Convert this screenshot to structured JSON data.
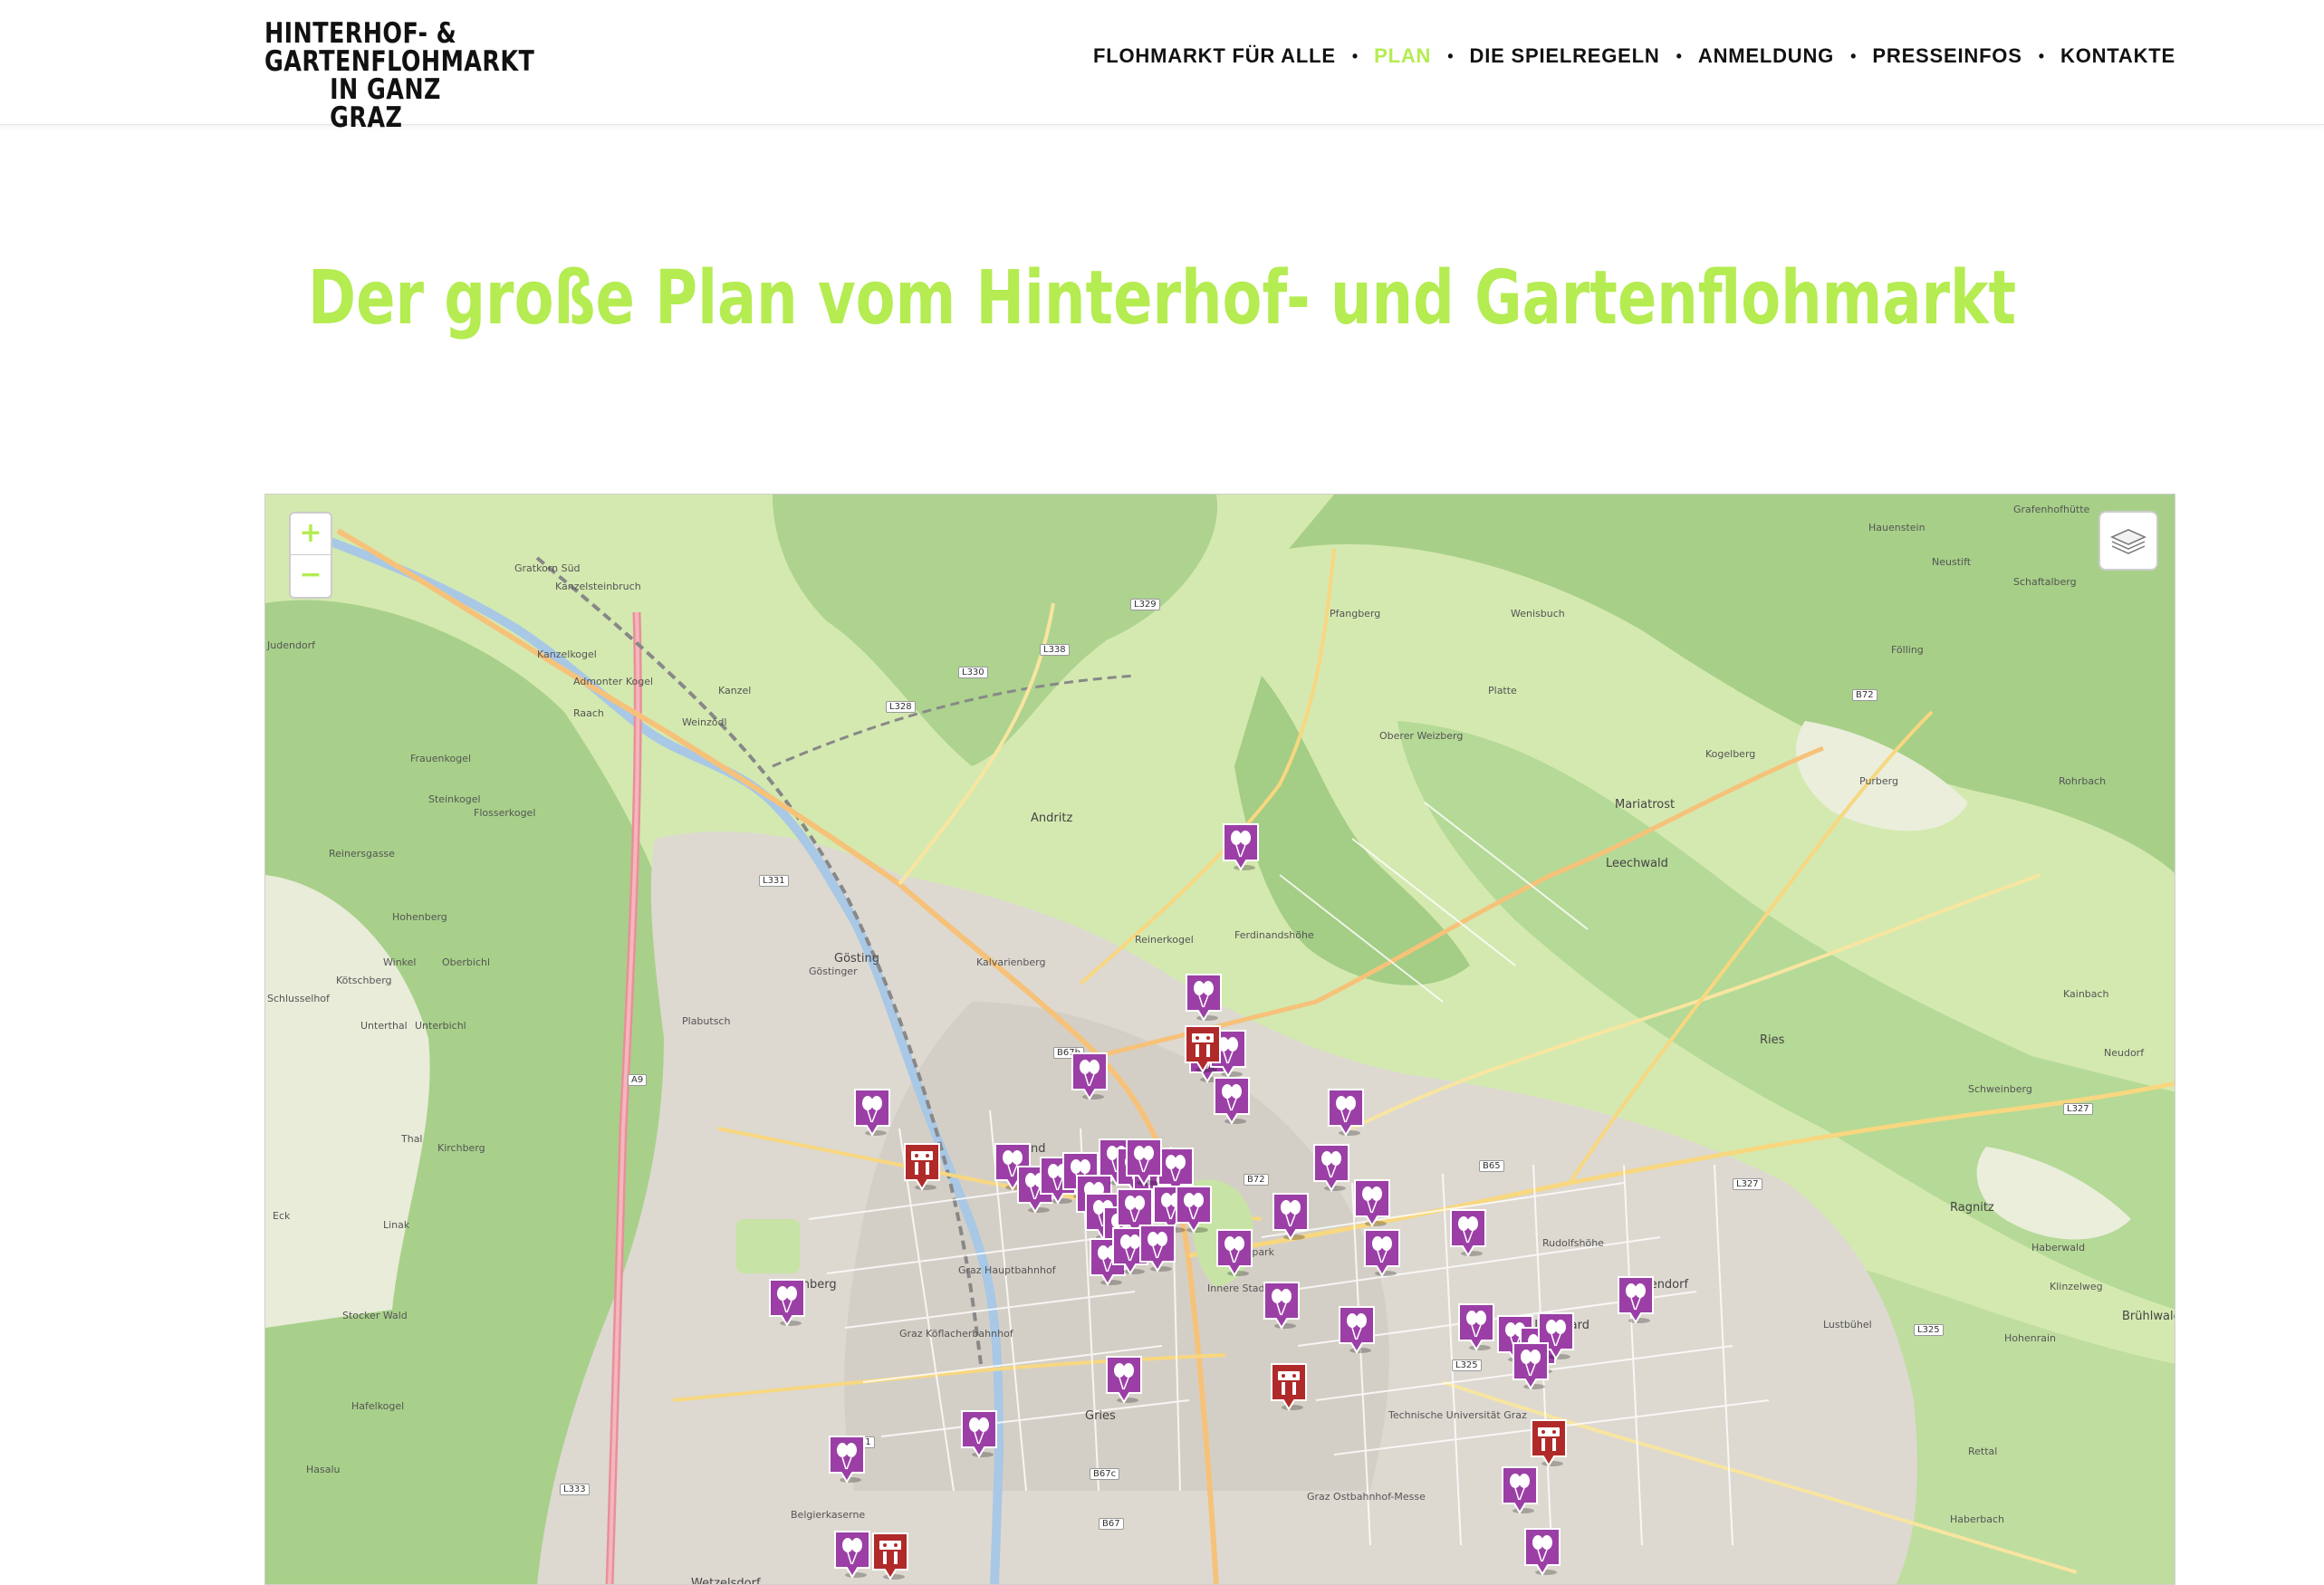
{
  "header": {
    "logo_lines": [
      "HINTERHOF- &",
      "GARTENFLOHMARKT",
      "IN GANZ GRAZ"
    ],
    "nav": [
      {
        "label": "FLOHMARKT FÜR ALLE",
        "active": false
      },
      {
        "label": "PLAN",
        "active": true
      },
      {
        "label": "DIE SPIELREGELN",
        "active": false
      },
      {
        "label": "ANMELDUNG",
        "active": false
      },
      {
        "label": "PRESSEINFOS",
        "active": false
      },
      {
        "label": "KONTAKTE",
        "active": false
      }
    ],
    "accent_color": "#b4ec51"
  },
  "page": {
    "title": "Der große Plan vom Hinterhof- und Gartenflohmarkt"
  },
  "map": {
    "zoom_in": "+",
    "zoom_out": "−",
    "layers_icon": "layers-icon",
    "marker_types": {
      "flohmarkt": {
        "icon": "balloons-icon",
        "color": "#9b3fa6"
      },
      "info": {
        "icon": "stand-icon",
        "color": "#b02a2a"
      }
    },
    "place_labels": [
      "Judendorf",
      "Gratkorn Süd",
      "Kanzelsteinbruch",
      "Kanzelkogel",
      "Admonter Kogel",
      "Kanzel",
      "Raach",
      "Weinzödl",
      "Andritz",
      "Frauenkogel",
      "Steinkogel",
      "Flosserkogel",
      "Reinersgasse",
      "Plabutsch",
      "Göstinger",
      "Hohenberg",
      "Winkel",
      "Oberbichl",
      "Kötschberg",
      "Schlusselhof",
      "Unterthal",
      "Unterbichl",
      "Thal",
      "Kirchberg",
      "Eck",
      "Linak",
      "Stocker Wald",
      "Hafelkogel",
      "Hasalu",
      "Gösting",
      "Kalvarienberg",
      "Lend",
      "Eggenberg",
      "Graz Hauptbahnhof",
      "Graz Köflacherbahnhof",
      "Gries",
      "Wetzelsdorf",
      "Belgierkaserne",
      "Ferdinandshöhe",
      "Reinerkogel",
      "Mariatrost",
      "Leechwald",
      "Ries",
      "Waltendorf",
      "Ragnitz",
      "Haberwald",
      "Brühlwald",
      "Pfangberg",
      "Wenisbuch",
      "Fölling",
      "Schaftalberg",
      "Platte",
      "Oberer Weizberg",
      "Kogelberg",
      "Purberg",
      "Rohrbach",
      "Kainbach",
      "Neudorf",
      "Schweinberg",
      "Rudolfshöhe",
      "Lustbühel",
      "Graz Ostbahnhof-Messe",
      "Technische Universität Graz",
      "Hauenstein",
      "Neustift",
      "Grafenhofhütte",
      "Klinzelweg",
      "Rettal",
      "Haberbach",
      "Hohenrain",
      "Sankt Leonhard",
      "Stadtpark",
      "Innere Stadt"
    ],
    "road_labels": [
      "L329",
      "L338",
      "L330",
      "L328",
      "L331",
      "B67b",
      "B72",
      "B65",
      "L327",
      "L325",
      "L301",
      "B67c",
      "B67",
      "A9",
      "L333",
      "B72",
      "L325",
      "L327"
    ]
  }
}
